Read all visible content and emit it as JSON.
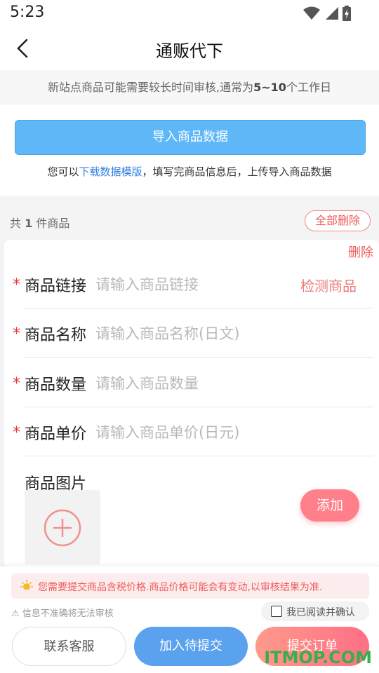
{
  "status_bar": {
    "time": "5:23"
  },
  "nav": {
    "title": "通贩代下"
  },
  "notice": {
    "prefix": "新站点商品可能需要较长时间审核,通常为",
    "highlight": "5~10",
    "suffix": "个工作日"
  },
  "import": {
    "button_label": "导入商品数据",
    "hint_prefix": "您可以",
    "hint_link": "下载数据模版",
    "hint_suffix": "，填写完商品信息后，上传导入商品数据"
  },
  "items_header": {
    "count_prefix": "共",
    "count": "1",
    "count_suffix": "件商品",
    "delete_all": "全部删除"
  },
  "item_card": {
    "delete_label": "删除",
    "fields": [
      {
        "label": "商品链接",
        "placeholder": "请输入商品链接",
        "action": "检测商品"
      },
      {
        "label": "商品名称",
        "placeholder": "请输入商品名称(日文)"
      },
      {
        "label": "商品数量",
        "placeholder": "请输入商品数量"
      },
      {
        "label": "商品单价",
        "placeholder": "请输入商品单价(日元)"
      }
    ],
    "required_mark": "*",
    "image_label": "商品图片"
  },
  "add_button": "添加",
  "bottom": {
    "tax_notice": "您需要提交商品含税价格.商品价格可能会有变动,以审核结果为准.",
    "warning": "信息不准确将无法审核",
    "agree_label": "我已阅读并确认",
    "buttons": {
      "service": "联系客服",
      "pending": "加入待提交",
      "submit": "提交订单"
    }
  },
  "watermark": "ITMOP.COM",
  "colors": {
    "primary_blue": "#5eb7f7",
    "accent_red": "#ee5b5b",
    "submit_pink": "#ff6f86"
  }
}
